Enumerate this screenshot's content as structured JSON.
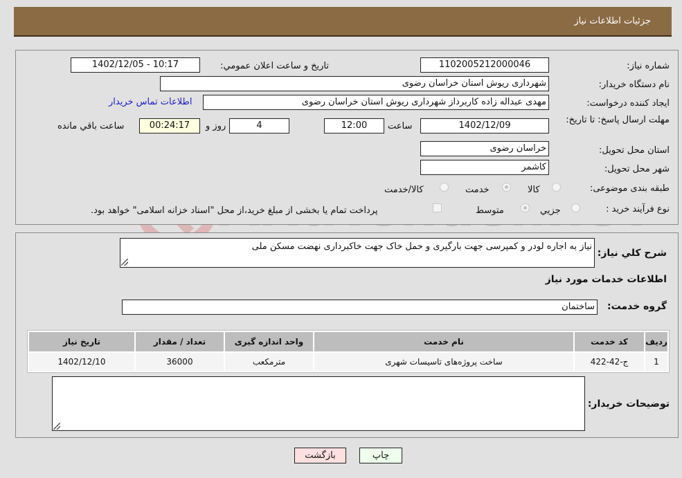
{
  "header": {
    "title": "جزئیات اطلاعات نیاز"
  },
  "form": {
    "need_number": {
      "label": "شماره نیاز:",
      "value": "1102005212000046"
    },
    "announce_datetime": {
      "label": "تاریخ و ساعت اعلان عمومي:",
      "value": "1402/12/05 - 10:17"
    },
    "buyer_org": {
      "label": "نام دستگاه خریدار:",
      "value": "شهرداری ریوش استان خراسان رضوی"
    },
    "requester": {
      "label": "ایجاد کننده درخواست:",
      "value": "مهدی عبداله زاده کاربرداز شهرداری ریوش استان خراسان رضوی"
    },
    "contact_link": "اطلاعات تماس خریدار",
    "deadline": {
      "label": "مهلت ارسال پاسخ: تا تاریخ:",
      "date": "1402/12/09",
      "time_label": "ساعت",
      "time": "12:00",
      "days": "4",
      "days_label": "روز و",
      "remaining": "00:24:17",
      "remaining_label": "ساعت باقي مانده"
    },
    "province": {
      "label": "استان محل تحویل:",
      "value": "خراسان رضوی"
    },
    "city": {
      "label": "شهر محل تحویل:",
      "value": "کاشمر"
    },
    "category": {
      "label": "طبقه بندی موضوعی:",
      "options": [
        "کالا",
        "خدمت",
        "کالا/خدمت"
      ],
      "selected": "خدمت"
    },
    "purchase_type": {
      "label": "نوع فرآیند خرید :",
      "options": [
        "جزيي",
        "متوسط"
      ],
      "selected": "متوسط",
      "treasury_checkbox_label": "پرداخت تمام یا بخشی از مبلغ خرید،از محل \"اسناد خزانه اسلامی\" خواهد بود.",
      "treasury_checked": false
    }
  },
  "description": {
    "label": "شرح كلي نياز:",
    "value": "نیاز به اجاره لودر و کمپرسی جهت بارگیری و حمل خاک جهت خاکبرداری نهضت مسکن ملی"
  },
  "services_section": {
    "title": "اطلاعات خدمات مورد نیاز",
    "group_label": "گروه خدمت:",
    "group_value": "ساختمان",
    "table": {
      "headers": [
        "ردیف",
        "کد خدمت",
        "نام خدمت",
        "واحد اندازه گیری",
        "تعداد / مقدار",
        "تاریخ نیاز"
      ],
      "rows": [
        [
          "1",
          "ج-42-422",
          "ساخت پروژه‌های تاسیسات شهری",
          "مترمکعب",
          "36000",
          "1402/12/10"
        ]
      ]
    }
  },
  "buyer_notes": {
    "label": "توضیحات خریدار:",
    "value": ""
  },
  "buttons": {
    "print": "چاپ",
    "back": "بازگشت"
  },
  "watermark": {
    "text": "AriaTender.neT"
  },
  "colors": {
    "header_bg": "#8b6b43",
    "print_bg": "#eeffee",
    "back_bg": "#ffe0e0",
    "link": "#1a1acc"
  }
}
